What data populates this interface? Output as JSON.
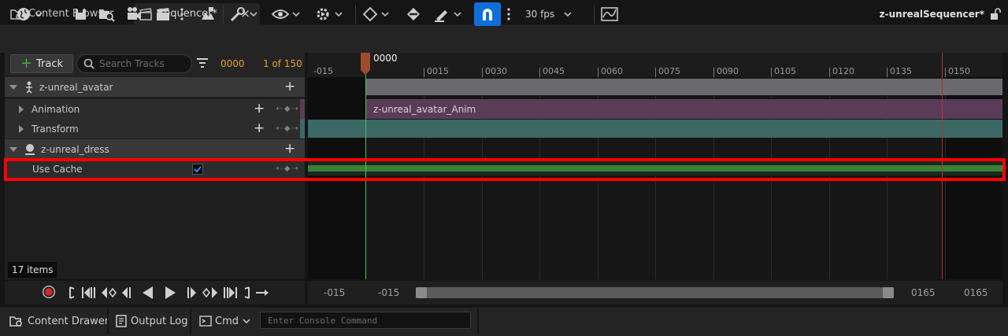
{
  "tabs": [
    {
      "label": "Content Browser",
      "icon": "folder-icon"
    },
    {
      "label": "Sequencer*",
      "icon": "clapperboard-icon"
    }
  ],
  "tab_close": "×",
  "toolbar": {
    "fps_label": "30 fps",
    "sequence_name": "z-unrealSequencer*",
    "snap_active_color": "#0e6fd8"
  },
  "left_panel": {
    "add_track_label": "Track",
    "search_placeholder": "Search Tracks",
    "current_frame": "0000",
    "frame_count": "1 of 150",
    "items_count": "17 items"
  },
  "tracks": [
    {
      "label": "z-unreal_avatar",
      "type": "actor",
      "icon": "skeleton-icon"
    },
    {
      "label": "Animation",
      "type": "sub",
      "stripe": "#5b3c58"
    },
    {
      "label": "Transform",
      "type": "sub",
      "stripe": "#3c6866"
    },
    {
      "label": "z-unreal_dress",
      "type": "actor",
      "icon": "geometry-cache-icon"
    },
    {
      "label": "Use Cache",
      "type": "property",
      "checked": true
    }
  ],
  "timeline": {
    "playhead_label": "0000",
    "ticks": [
      "-015",
      "0015",
      "0030",
      "0045",
      "0060",
      "0075",
      "0090",
      "0105",
      "0120",
      "0135",
      "0150"
    ],
    "anim_section_label": "z-unreal_avatar_Anim",
    "range_start_outer": "-015",
    "range_start_inner": "-015",
    "range_end_inner": "0165",
    "range_end_outer": "0165",
    "playhead_color": "#4cc24c",
    "end_marker_color": "#b43030"
  },
  "statusbar": {
    "content_drawer": "Content Drawer",
    "output_log": "Output Log",
    "cmd": "Cmd",
    "console_placeholder": "Enter Console Command"
  }
}
